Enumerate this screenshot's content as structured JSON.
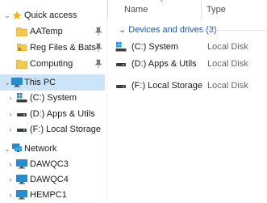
{
  "nav": {
    "quick_access": "Quick access",
    "pinned": [
      {
        "label": "AATemp"
      },
      {
        "label": "Reg Files & Bats"
      },
      {
        "label": "Computing"
      }
    ],
    "this_pc": "This PC",
    "drives": [
      {
        "label": "(C:) System"
      },
      {
        "label": "(D:) Apps & Utils"
      },
      {
        "label": "(F:) Local Storage"
      }
    ],
    "network": "Network",
    "computers": [
      {
        "label": "DAWQC3"
      },
      {
        "label": "DAWQC4"
      },
      {
        "label": "HEMPC1"
      }
    ]
  },
  "main": {
    "columns": {
      "name": "Name",
      "type": "Type"
    },
    "group_label": "Devices and drives (3)",
    "items": [
      {
        "name": "(C:) System",
        "type": "Local Disk"
      },
      {
        "name": "(D:) Apps & Utils",
        "type": "Local Disk"
      },
      {
        "name": "(F:) Local Storage",
        "type": "Local Disk"
      }
    ]
  },
  "colors": {
    "selection": "#cce4f7",
    "group_text": "#1e5aa8",
    "folder": "#f2c94c",
    "star": "#f5b400",
    "monitor": "#1f8fd6"
  }
}
